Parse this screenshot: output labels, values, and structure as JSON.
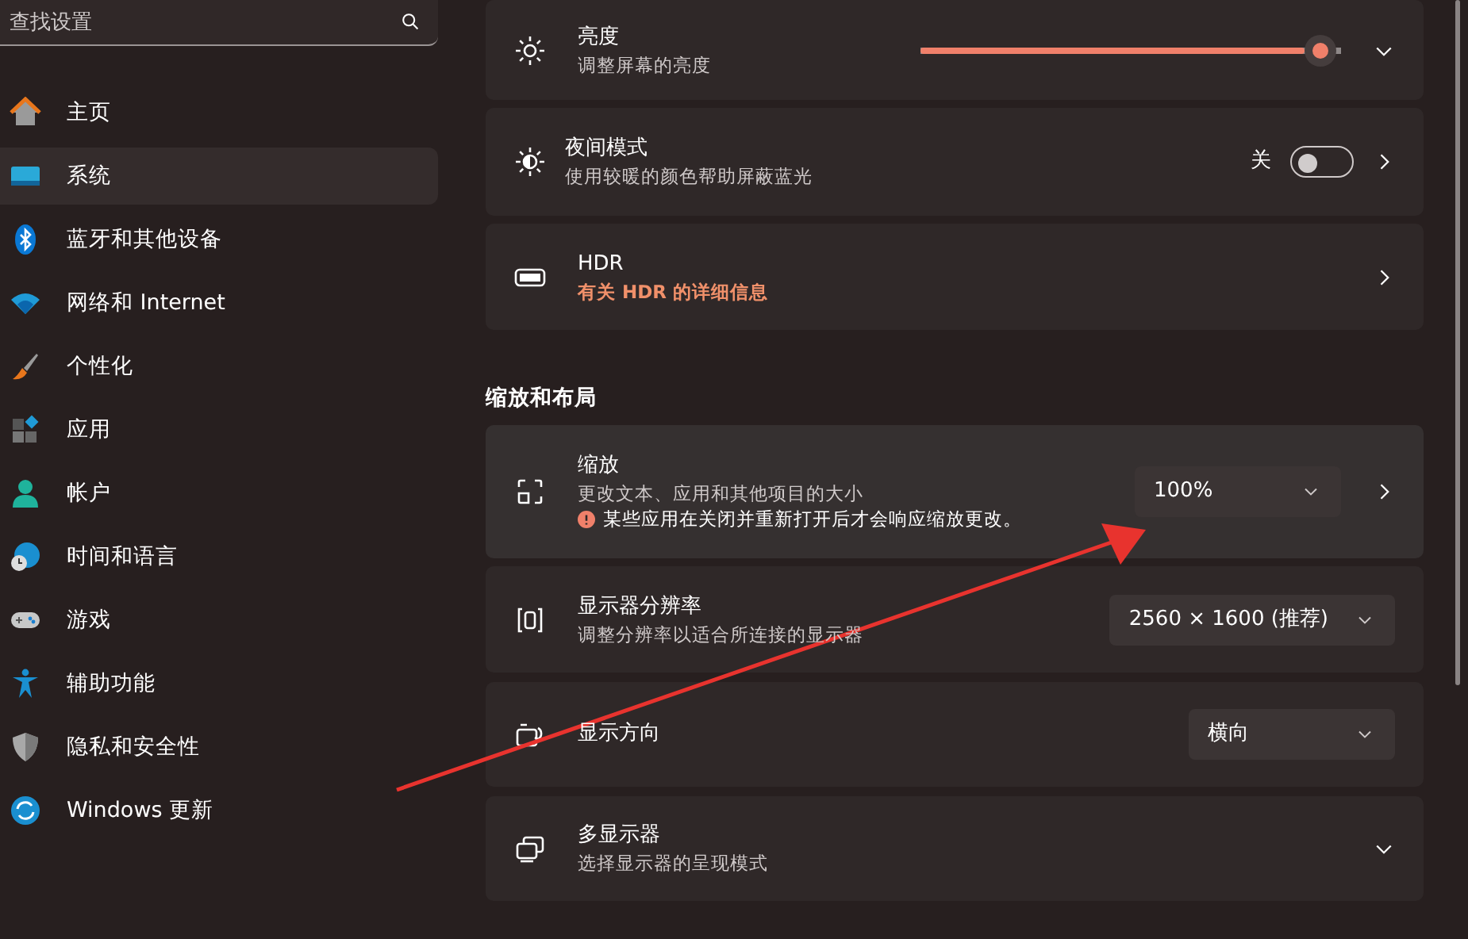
{
  "search": {
    "placeholder": "查找设置"
  },
  "nav": [
    {
      "label": "主页",
      "selected": false
    },
    {
      "label": "系统",
      "selected": true
    },
    {
      "label": "蓝牙和其他设备",
      "selected": false
    },
    {
      "label": "网络和 Internet",
      "selected": false
    },
    {
      "label": "个性化",
      "selected": false
    },
    {
      "label": "应用",
      "selected": false
    },
    {
      "label": "帐户",
      "selected": false
    },
    {
      "label": "时间和语言",
      "selected": false
    },
    {
      "label": "游戏",
      "selected": false
    },
    {
      "label": "辅助功能",
      "selected": false
    },
    {
      "label": "隐私和安全性",
      "selected": false
    },
    {
      "label": "Windows 更新",
      "selected": false
    }
  ],
  "display_cards": [
    {
      "kind": "slider",
      "title": "亮度",
      "description": "调整屏幕的亮度",
      "level": 0.95
    },
    {
      "kind": "toggle",
      "title": "夜间模式",
      "description": "使用较暖的颜色帮助屏蔽蓝光",
      "state_label": "关",
      "on": false
    },
    {
      "kind": "link",
      "title": "HDR",
      "description": "有关 HDR 的详细信息",
      "description_is_link": true
    }
  ],
  "section_heading": "缩放和布局",
  "layout_cards": [
    {
      "kind": "dropdown",
      "title": "缩放",
      "description": "更改文本、应用和其他项目的大小",
      "warning": "某些应用在关闭并重新打开后才会响应缩放更改。",
      "value": "100%",
      "chevron": true
    },
    {
      "kind": "dropdown",
      "title": "显示器分辨率",
      "description": "调整分辨率以适合所连接的显示器",
      "value": "2560 × 1600 (推荐)",
      "chevron": false
    },
    {
      "kind": "dropdown",
      "title": "显示方向",
      "value": "横向",
      "chevron": false
    },
    {
      "kind": "expand",
      "title": "多显示器",
      "description": "选择显示器的呈现模式"
    }
  ]
}
